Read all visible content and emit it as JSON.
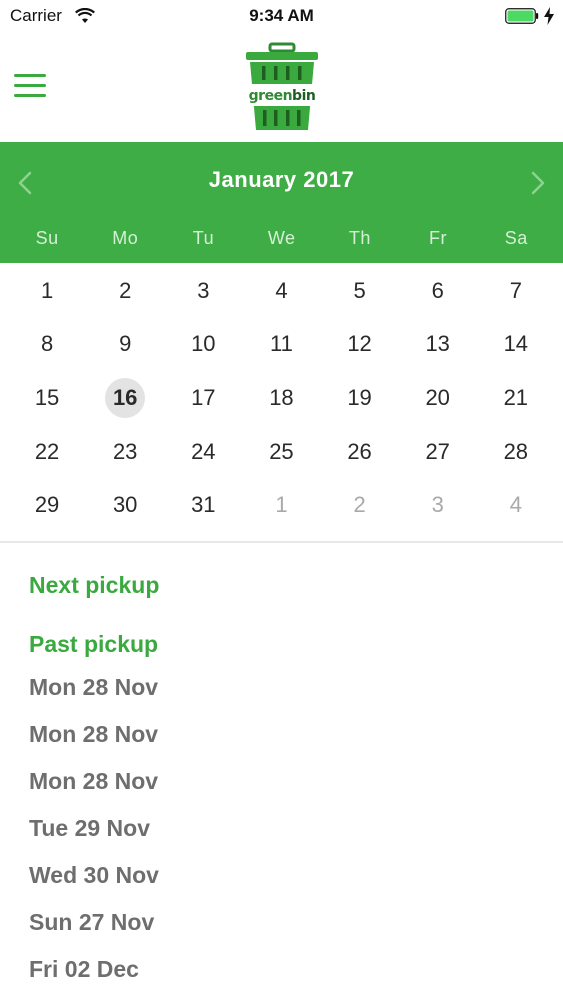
{
  "status_bar": {
    "carrier": "Carrier",
    "time": "9:34 AM"
  },
  "header": {
    "logo_word_1": "green",
    "logo_word_2": "bin"
  },
  "calendar": {
    "month_title": "January 2017",
    "weekdays": [
      "Su",
      "Mo",
      "Tu",
      "We",
      "Th",
      "Fr",
      "Sa"
    ],
    "weeks": [
      [
        {
          "label": "1",
          "other": false
        },
        {
          "label": "2",
          "other": false
        },
        {
          "label": "3",
          "other": false
        },
        {
          "label": "4",
          "other": false
        },
        {
          "label": "5",
          "other": false
        },
        {
          "label": "6",
          "other": false
        },
        {
          "label": "7",
          "other": false
        }
      ],
      [
        {
          "label": "8",
          "other": false
        },
        {
          "label": "9",
          "other": false
        },
        {
          "label": "10",
          "other": false
        },
        {
          "label": "11",
          "other": false
        },
        {
          "label": "12",
          "other": false
        },
        {
          "label": "13",
          "other": false
        },
        {
          "label": "14",
          "other": false
        }
      ],
      [
        {
          "label": "15",
          "other": false
        },
        {
          "label": "16",
          "other": false,
          "selected": true
        },
        {
          "label": "17",
          "other": false
        },
        {
          "label": "18",
          "other": false
        },
        {
          "label": "19",
          "other": false
        },
        {
          "label": "20",
          "other": false
        },
        {
          "label": "21",
          "other": false
        }
      ],
      [
        {
          "label": "22",
          "other": false
        },
        {
          "label": "23",
          "other": false
        },
        {
          "label": "24",
          "other": false
        },
        {
          "label": "25",
          "other": false
        },
        {
          "label": "26",
          "other": false
        },
        {
          "label": "27",
          "other": false
        },
        {
          "label": "28",
          "other": false
        }
      ],
      [
        {
          "label": "29",
          "other": false
        },
        {
          "label": "30",
          "other": false
        },
        {
          "label": "31",
          "other": false
        },
        {
          "label": "1",
          "other": true
        },
        {
          "label": "2",
          "other": true
        },
        {
          "label": "3",
          "other": true
        },
        {
          "label": "4",
          "other": true
        }
      ]
    ],
    "accent_color": "#3fad45",
    "selected_bg_color": "#e3e3e3"
  },
  "pickups": {
    "next_title": "Next pickup",
    "past_title": "Past pickup",
    "past_items": [
      "Mon 28 Nov",
      "Mon 28 Nov",
      "Mon 28 Nov",
      "Tue 29 Nov",
      "Wed 30 Nov",
      "Sun 27 Nov",
      "Fri 02 Dec"
    ]
  },
  "icons": {
    "wifi": "wifi-icon",
    "battery": "battery-icon",
    "charging": "charging-bolt-icon",
    "menu": "hamburger-menu-icon",
    "logo": "trash-bin-logo-icon",
    "prev": "chevron-left-icon",
    "next": "chevron-right-icon"
  }
}
